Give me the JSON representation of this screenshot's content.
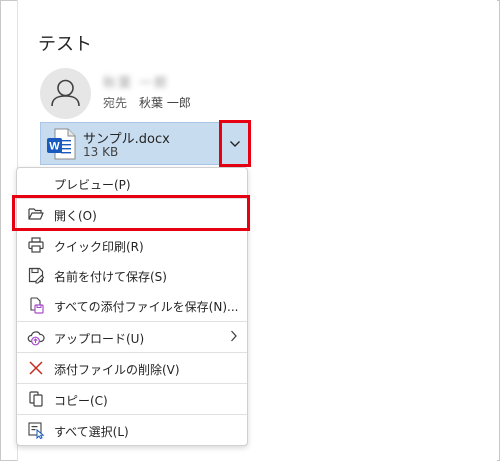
{
  "email": {
    "subject": "テスト",
    "sender_name": "秋葉 一郎",
    "recipient_label": "宛先",
    "recipient_name": "秋葉 一郎"
  },
  "attachment": {
    "file_name": "サンプル.docx",
    "file_size": "13 KB",
    "file_icon": "word-doc-icon"
  },
  "context_menu": {
    "items": [
      {
        "label": "プレビュー(P)",
        "icon": "none"
      },
      {
        "label": "開く(O)",
        "icon": "folder-open-icon"
      },
      {
        "label": "クイック印刷(R)",
        "icon": "printer-icon"
      },
      {
        "label": "名前を付けて保存(S)",
        "icon": "save-as-icon"
      },
      {
        "label": "すべての添付ファイルを保存(N)...",
        "icon": "save-all-icon"
      },
      {
        "label": "アップロード(U)",
        "icon": "cloud-upload-icon",
        "submenu": true
      },
      {
        "label": "添付ファイルの削除(V)",
        "icon": "delete-icon"
      },
      {
        "label": "コピー(C)",
        "icon": "copy-icon"
      },
      {
        "label": "すべて選択(L)",
        "icon": "select-all-icon"
      }
    ]
  },
  "colors": {
    "attachment_bg": "#c8dcf0",
    "highlight_red": "#e60012",
    "word_blue": "#185abd",
    "delete_red": "#c42b1c",
    "upload_purple": "#a64dc9"
  }
}
